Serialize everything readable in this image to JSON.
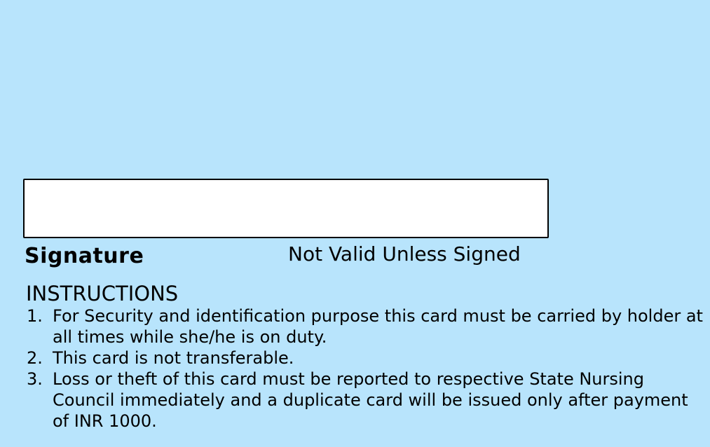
{
  "card": {
    "signature_label": "Signature",
    "validity_note": "Not Valid Unless Signed",
    "instructions_heading": "INSTRUCTIONS",
    "instructions": [
      {
        "number": "1.",
        "text": "For Security and identification purpose this card must be carried by holder at all times while she/he is on duty."
      },
      {
        "number": "2.",
        "text": "This card is not transferable."
      },
      {
        "number": "3.",
        "text": "Loss or theft of this card must be reported to respective State Nursing Council immediately and a duplicate card will be issued only after payment of INR 1000."
      }
    ]
  }
}
